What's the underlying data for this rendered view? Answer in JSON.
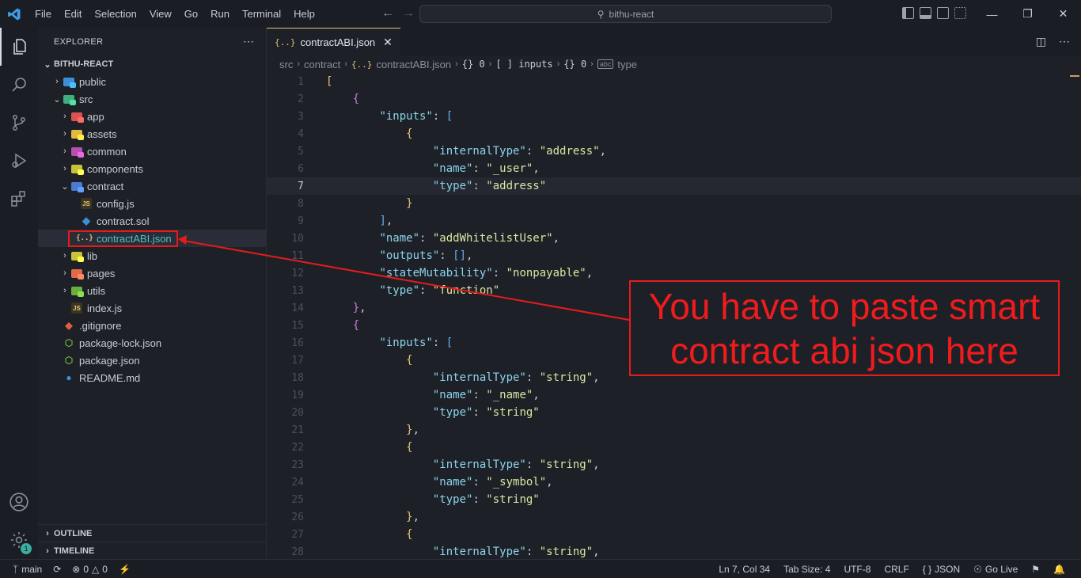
{
  "menu": [
    "File",
    "Edit",
    "Selection",
    "View",
    "Go",
    "Run",
    "Terminal",
    "Help"
  ],
  "search": {
    "text": "bithu-react"
  },
  "explorer": {
    "title": "EXPLORER",
    "project": "BITHU-REACT",
    "outline": "OUTLINE",
    "timeline": "TIMELINE",
    "items": [
      {
        "label": "public"
      },
      {
        "label": "src"
      },
      {
        "label": "app"
      },
      {
        "label": "assets"
      },
      {
        "label": "common"
      },
      {
        "label": "components"
      },
      {
        "label": "contract"
      },
      {
        "label": "config.js"
      },
      {
        "label": "contract.sol"
      },
      {
        "label": "contractABI.json"
      },
      {
        "label": "lib"
      },
      {
        "label": "pages"
      },
      {
        "label": "utils"
      },
      {
        "label": "index.js"
      },
      {
        "label": ".gitignore"
      },
      {
        "label": "package-lock.json"
      },
      {
        "label": "package.json"
      },
      {
        "label": "README.md"
      }
    ]
  },
  "accounts_badge": "1",
  "tab": {
    "label": "contractABI.json",
    "icon": "{..}"
  },
  "breadcrumb": {
    "src": "src",
    "contract": "contract",
    "file": "contractABI.json",
    "obj0": "{} 0",
    "inputs": "[ ] inputs",
    "obj0b": "{} 0",
    "type": "type"
  },
  "code": {
    "line_numbers": [
      "1",
      "2",
      "3",
      "4",
      "5",
      "6",
      "7",
      "8",
      "9",
      "10",
      "11",
      "12",
      "13",
      "14",
      "15",
      "16",
      "17",
      "18",
      "19",
      "20",
      "21",
      "22",
      "23",
      "24",
      "25",
      "26",
      "27",
      "28"
    ]
  },
  "annotation": {
    "line1": "You have to paste smart",
    "line2": "contract abi json here",
    "color": "#e81b1b"
  },
  "status": {
    "branch": "main",
    "problems": "0",
    "warnings": "0",
    "position": "Ln 7, Col 34",
    "tabsize": "Tab Size: 4",
    "encoding": "UTF-8",
    "eol": "CRLF",
    "language": "JSON",
    "golive": "Go Live"
  }
}
